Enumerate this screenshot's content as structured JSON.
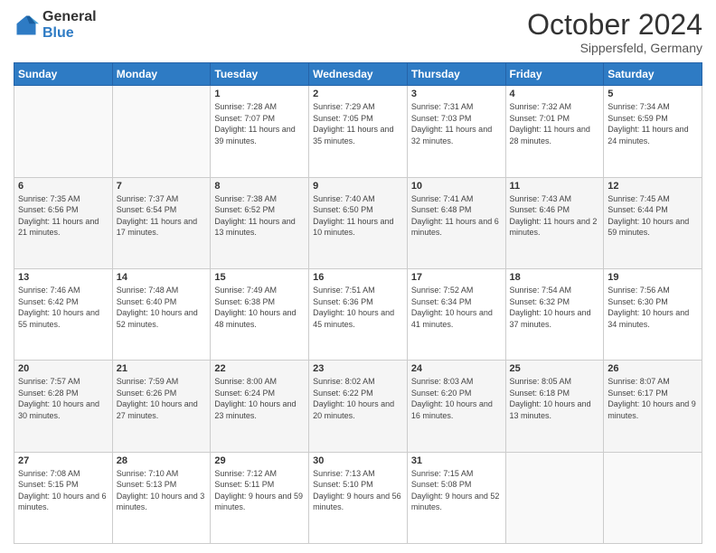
{
  "logo": {
    "line1": "General",
    "line2": "Blue"
  },
  "title": "October 2024",
  "subtitle": "Sippersfeld, Germany",
  "days_header": [
    "Sunday",
    "Monday",
    "Tuesday",
    "Wednesday",
    "Thursday",
    "Friday",
    "Saturday"
  ],
  "weeks": [
    [
      {
        "day": "",
        "info": ""
      },
      {
        "day": "",
        "info": ""
      },
      {
        "day": "1",
        "info": "Sunrise: 7:28 AM\nSunset: 7:07 PM\nDaylight: 11 hours and 39 minutes."
      },
      {
        "day": "2",
        "info": "Sunrise: 7:29 AM\nSunset: 7:05 PM\nDaylight: 11 hours and 35 minutes."
      },
      {
        "day": "3",
        "info": "Sunrise: 7:31 AM\nSunset: 7:03 PM\nDaylight: 11 hours and 32 minutes."
      },
      {
        "day": "4",
        "info": "Sunrise: 7:32 AM\nSunset: 7:01 PM\nDaylight: 11 hours and 28 minutes."
      },
      {
        "day": "5",
        "info": "Sunrise: 7:34 AM\nSunset: 6:59 PM\nDaylight: 11 hours and 24 minutes."
      }
    ],
    [
      {
        "day": "6",
        "info": "Sunrise: 7:35 AM\nSunset: 6:56 PM\nDaylight: 11 hours and 21 minutes."
      },
      {
        "day": "7",
        "info": "Sunrise: 7:37 AM\nSunset: 6:54 PM\nDaylight: 11 hours and 17 minutes."
      },
      {
        "day": "8",
        "info": "Sunrise: 7:38 AM\nSunset: 6:52 PM\nDaylight: 11 hours and 13 minutes."
      },
      {
        "day": "9",
        "info": "Sunrise: 7:40 AM\nSunset: 6:50 PM\nDaylight: 11 hours and 10 minutes."
      },
      {
        "day": "10",
        "info": "Sunrise: 7:41 AM\nSunset: 6:48 PM\nDaylight: 11 hours and 6 minutes."
      },
      {
        "day": "11",
        "info": "Sunrise: 7:43 AM\nSunset: 6:46 PM\nDaylight: 11 hours and 2 minutes."
      },
      {
        "day": "12",
        "info": "Sunrise: 7:45 AM\nSunset: 6:44 PM\nDaylight: 10 hours and 59 minutes."
      }
    ],
    [
      {
        "day": "13",
        "info": "Sunrise: 7:46 AM\nSunset: 6:42 PM\nDaylight: 10 hours and 55 minutes."
      },
      {
        "day": "14",
        "info": "Sunrise: 7:48 AM\nSunset: 6:40 PM\nDaylight: 10 hours and 52 minutes."
      },
      {
        "day": "15",
        "info": "Sunrise: 7:49 AM\nSunset: 6:38 PM\nDaylight: 10 hours and 48 minutes."
      },
      {
        "day": "16",
        "info": "Sunrise: 7:51 AM\nSunset: 6:36 PM\nDaylight: 10 hours and 45 minutes."
      },
      {
        "day": "17",
        "info": "Sunrise: 7:52 AM\nSunset: 6:34 PM\nDaylight: 10 hours and 41 minutes."
      },
      {
        "day": "18",
        "info": "Sunrise: 7:54 AM\nSunset: 6:32 PM\nDaylight: 10 hours and 37 minutes."
      },
      {
        "day": "19",
        "info": "Sunrise: 7:56 AM\nSunset: 6:30 PM\nDaylight: 10 hours and 34 minutes."
      }
    ],
    [
      {
        "day": "20",
        "info": "Sunrise: 7:57 AM\nSunset: 6:28 PM\nDaylight: 10 hours and 30 minutes."
      },
      {
        "day": "21",
        "info": "Sunrise: 7:59 AM\nSunset: 6:26 PM\nDaylight: 10 hours and 27 minutes."
      },
      {
        "day": "22",
        "info": "Sunrise: 8:00 AM\nSunset: 6:24 PM\nDaylight: 10 hours and 23 minutes."
      },
      {
        "day": "23",
        "info": "Sunrise: 8:02 AM\nSunset: 6:22 PM\nDaylight: 10 hours and 20 minutes."
      },
      {
        "day": "24",
        "info": "Sunrise: 8:03 AM\nSunset: 6:20 PM\nDaylight: 10 hours and 16 minutes."
      },
      {
        "day": "25",
        "info": "Sunrise: 8:05 AM\nSunset: 6:18 PM\nDaylight: 10 hours and 13 minutes."
      },
      {
        "day": "26",
        "info": "Sunrise: 8:07 AM\nSunset: 6:17 PM\nDaylight: 10 hours and 9 minutes."
      }
    ],
    [
      {
        "day": "27",
        "info": "Sunrise: 7:08 AM\nSunset: 5:15 PM\nDaylight: 10 hours and 6 minutes."
      },
      {
        "day": "28",
        "info": "Sunrise: 7:10 AM\nSunset: 5:13 PM\nDaylight: 10 hours and 3 minutes."
      },
      {
        "day": "29",
        "info": "Sunrise: 7:12 AM\nSunset: 5:11 PM\nDaylight: 9 hours and 59 minutes."
      },
      {
        "day": "30",
        "info": "Sunrise: 7:13 AM\nSunset: 5:10 PM\nDaylight: 9 hours and 56 minutes."
      },
      {
        "day": "31",
        "info": "Sunrise: 7:15 AM\nSunset: 5:08 PM\nDaylight: 9 hours and 52 minutes."
      },
      {
        "day": "",
        "info": ""
      },
      {
        "day": "",
        "info": ""
      }
    ]
  ]
}
